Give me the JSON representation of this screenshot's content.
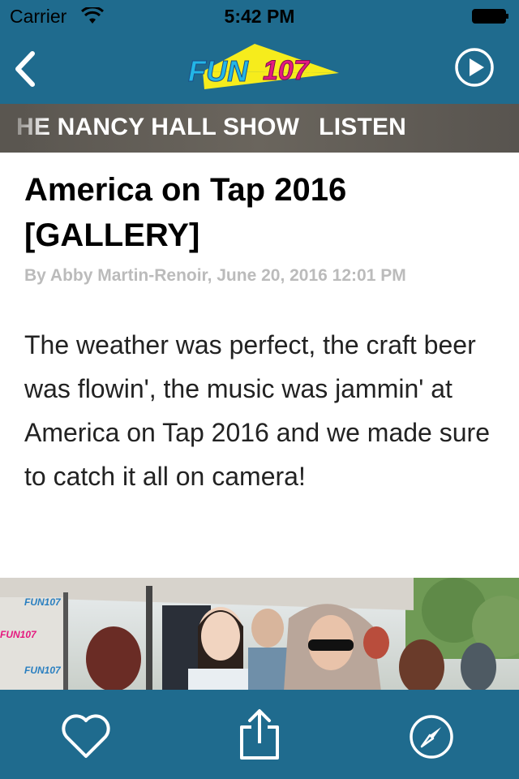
{
  "status_bar": {
    "carrier": "Carrier",
    "time": "5:42 PM"
  },
  "nav": {
    "logo_text": "FUN107",
    "back_icon": "chevron-left-icon",
    "play_icon": "play-circle-icon"
  },
  "ticker": {
    "show": "HE NANCY HALL SHOW",
    "listen": "LISTEN"
  },
  "article": {
    "title": "America on Tap 2016 [GALLERY]",
    "byline": "By Abby Martin-Renoir, June 20, 2016 12:01 PM",
    "body": "The weather was perfect, the craft beer was flowin', the music was jammin' at America on Tap 2016 and we made sure to catch it all on camera!"
  },
  "tab_bar": {
    "icons": [
      "heart-icon",
      "share-icon",
      "compass-icon"
    ]
  },
  "colors": {
    "brand_blue": "#1f6b8e",
    "logo_yellow": "#f6ec1c",
    "logo_pink": "#e5197f",
    "logo_cyan": "#23b6e6"
  }
}
